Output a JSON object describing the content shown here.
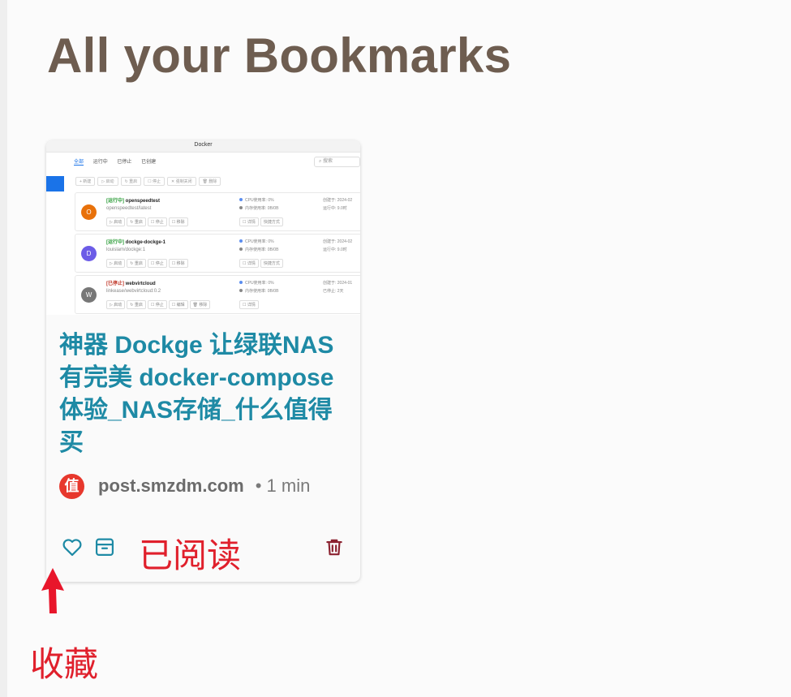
{
  "page": {
    "title": "All your Bookmarks"
  },
  "bookmark": {
    "title": "神器 Dockge 让绿联NAS 有完美 docker-compose 体验_NAS存储_什么值得买",
    "source_domain": "post.smzdm.com",
    "favicon_char": "值",
    "read_time": "• 1 min",
    "status_label": "已阅读",
    "favorite_icon": "heart-outline-icon",
    "archive_icon": "archive-box-icon",
    "delete_icon": "trash-icon",
    "accent_color": "#1e8aa5",
    "delete_color": "#8b2230",
    "thumbnail": {
      "app_title": "Docker",
      "tabs": [
        "全部",
        "运行中",
        "已停止",
        "已创建"
      ],
      "search_placeholder": "搜索",
      "toolbar": [
        "+ 新建",
        "▷ 启动",
        "↻ 重启",
        "☐ 停止",
        "✕ 强制关闭",
        "🗑 删除"
      ],
      "containers": [
        {
          "status": "[运行中]",
          "name": "openspeedtest",
          "image": "openspeedtest/latest",
          "avatar": "O",
          "avatar_color": "#e8710a",
          "cpu": "CPU使用率: 0%",
          "mem": "内存使用率: 0B/0B",
          "created": "创建于: 2024-02",
          "uptime": "运行中: 9.0时",
          "buttons": [
            "▷ 启动",
            "↻ 重启",
            "☐ 停止",
            "☐ 移除"
          ],
          "actions": [
            "☐ 详情",
            "快捷方式"
          ],
          "stopped": false
        },
        {
          "status": "[运行中]",
          "name": "dockge-dockge-1",
          "image": "louislam/dockge:1",
          "avatar": "D",
          "avatar_color": "#6c5ce7",
          "cpu": "CPU使用率: 0%",
          "mem": "内存使用率: 0B/0B",
          "created": "创建于: 2024-02",
          "uptime": "运行中: 9.0时",
          "buttons": [
            "▷ 启动",
            "↻ 重启",
            "☐ 停止",
            "☐ 移除"
          ],
          "actions": [
            "☐ 详情",
            "快捷方式"
          ],
          "stopped": false
        },
        {
          "status": "[已停止]",
          "name": "webvirtcloud",
          "image": "linkease/webvirtcloud:0.2",
          "avatar": "W",
          "avatar_color": "#777777",
          "cpu": "CPU使用率: 0%",
          "mem": "内存使用率: 0B/0B",
          "created": "创建于: 2024-01",
          "uptime": "已停止: 2天",
          "buttons": [
            "▷ 启动",
            "↻ 重启",
            "☐ 停止",
            "☐ 编辑",
            "🗑 移除"
          ],
          "actions": [
            "☐ 详情"
          ],
          "stopped": true
        }
      ]
    }
  },
  "annotation": {
    "favorite_label": "收藏",
    "arrow_color": "#e0202c"
  }
}
